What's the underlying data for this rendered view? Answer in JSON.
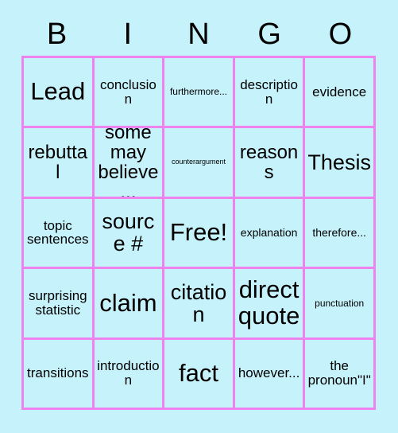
{
  "card": {
    "background_color": "#c6f2fb",
    "border_color": "#ee82ee",
    "text_color": "#000000"
  },
  "header": {
    "letters": [
      {
        "label": "B"
      },
      {
        "label": "I"
      },
      {
        "label": "N"
      },
      {
        "label": "G"
      },
      {
        "label": "O"
      }
    ]
  },
  "grid": {
    "columns": 5,
    "rows": 5,
    "free_space": {
      "row": 2,
      "column": 2,
      "label": "Free!"
    },
    "cells": [
      {
        "label": "Lead",
        "size": "xxl"
      },
      {
        "label": "conclusion",
        "size": "md"
      },
      {
        "label": "furthermore...",
        "size": "xs"
      },
      {
        "label": "description",
        "size": "md"
      },
      {
        "label": "evidence",
        "size": "md"
      },
      {
        "label": "rebuttal",
        "size": "lg"
      },
      {
        "label": "some may believe...",
        "size": "lg"
      },
      {
        "label": "counterargument",
        "size": "xxs"
      },
      {
        "label": "reasons",
        "size": "lg"
      },
      {
        "label": "Thesis",
        "size": "xl"
      },
      {
        "label": "topic sentences",
        "size": "md"
      },
      {
        "label": "source #",
        "size": "xl"
      },
      {
        "label": "Free!",
        "size": "xxl"
      },
      {
        "label": "explanation",
        "size": "sm"
      },
      {
        "label": "therefore...",
        "size": "sm"
      },
      {
        "label": "surprising statistic",
        "size": "md"
      },
      {
        "label": "claim",
        "size": "xxl"
      },
      {
        "label": "citation",
        "size": "xl"
      },
      {
        "label": "direct quote",
        "size": "xxl"
      },
      {
        "label": "punctuation",
        "size": "xs"
      },
      {
        "label": "transitions",
        "size": "md"
      },
      {
        "label": "introduction",
        "size": "md"
      },
      {
        "label": "fact",
        "size": "xxl"
      },
      {
        "label": "however...",
        "size": "md"
      },
      {
        "label": "the pronoun\"I\"",
        "size": "md"
      }
    ]
  }
}
